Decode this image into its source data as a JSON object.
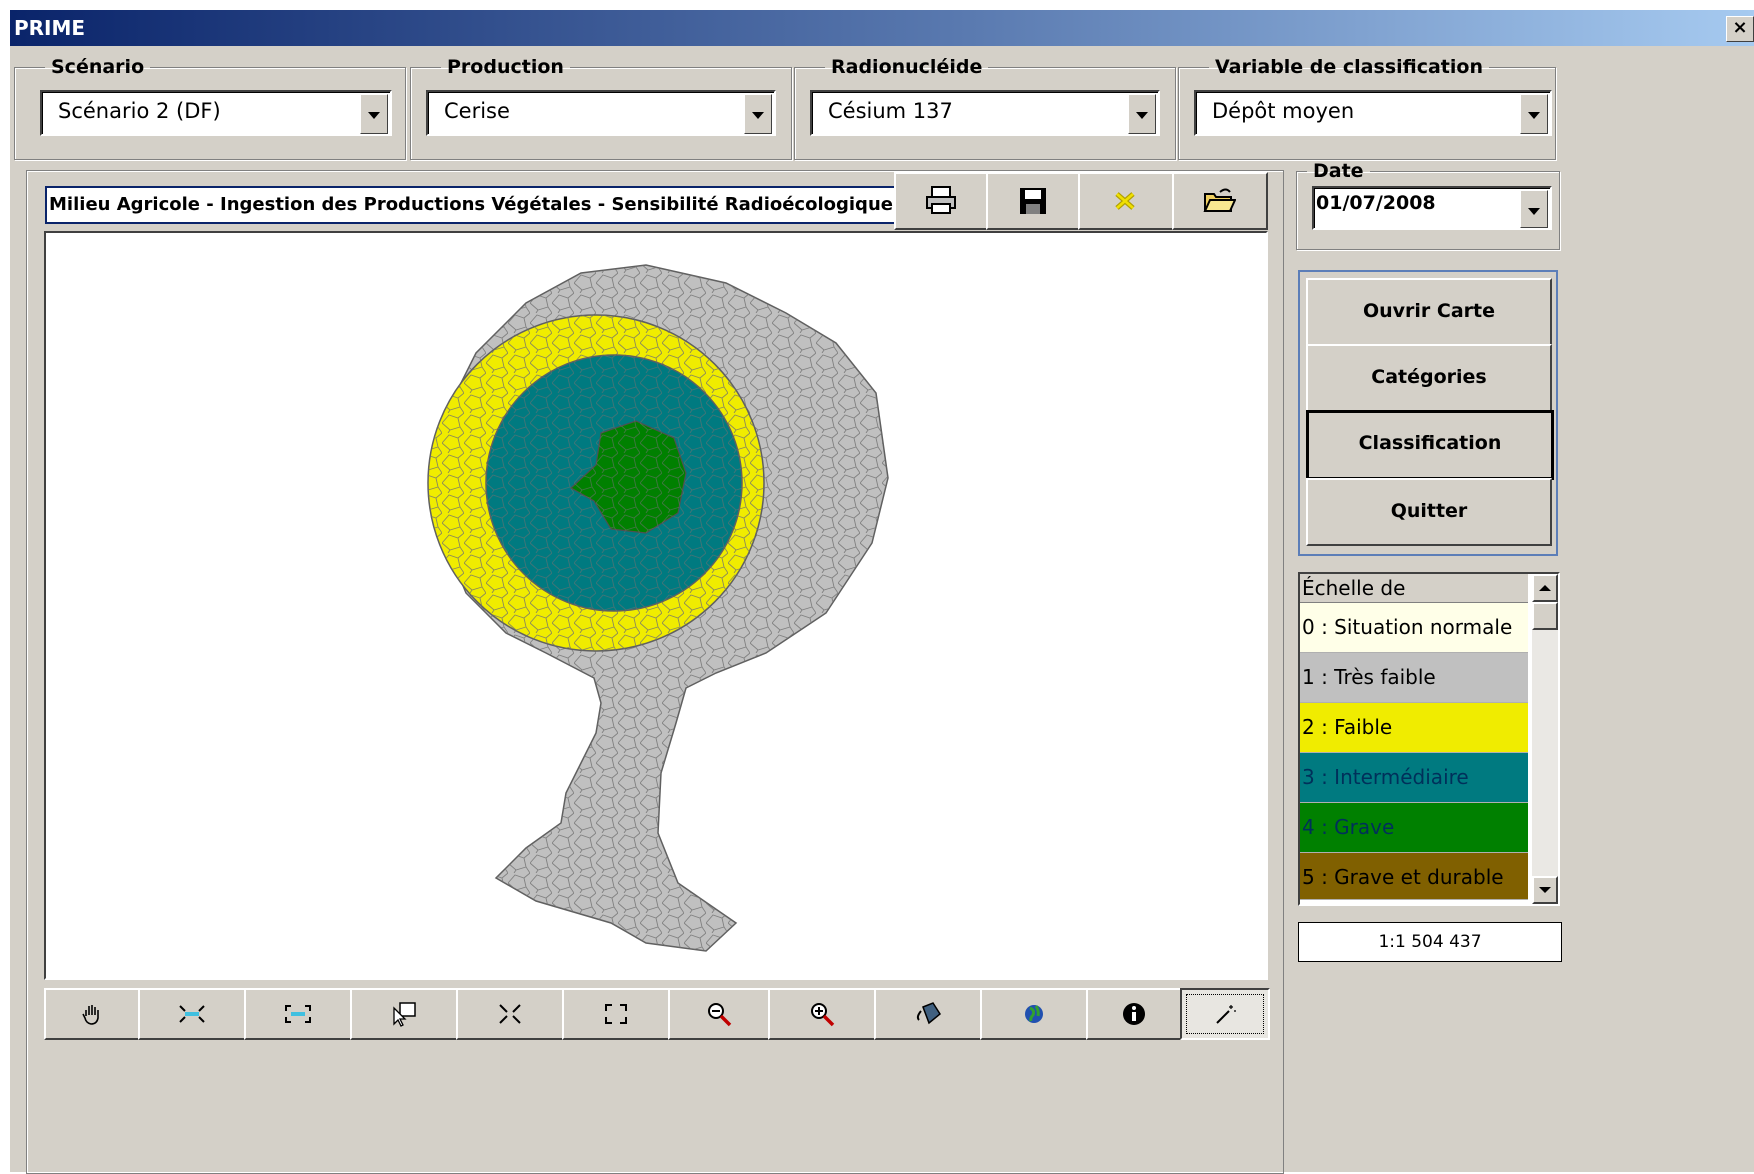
{
  "window": {
    "title": "PRIME",
    "close_label": "×"
  },
  "groups": {
    "scenario": {
      "label": "Scénario",
      "value": "Scénario 2 (DF)"
    },
    "production": {
      "label": "Production",
      "value": "Cerise"
    },
    "radionuclide": {
      "label": "Radionucléide",
      "value": "Césium 137"
    },
    "classification_variable": {
      "label": "Variable de classification",
      "value": "Dépôt moyen"
    },
    "date": {
      "label": "Date",
      "value": "01/07/2008"
    }
  },
  "map": {
    "title": "Milieu Agricole - Ingestion des Productions Végétales - Sensibilité Radioécologique",
    "scale": "1:1 504 437"
  },
  "toolbar_icons": [
    "printer-icon",
    "floppy-save-icon",
    "clear-icon",
    "open-folder-icon"
  ],
  "map_tools": [
    "pan-hand-icon",
    "zoom-in-fixed-icon",
    "zoom-out-fixed-icon",
    "select-feature-icon",
    "shrink-icon",
    "expand-icon",
    "zoom-out-icon",
    "zoom-in-icon",
    "paint-bucket-icon",
    "globe-icon",
    "info-icon",
    "magic-wand-icon"
  ],
  "commands": {
    "open_map": "Ouvrir Carte",
    "categories": "Catégories",
    "classification": "Classification",
    "quit": "Quitter"
  },
  "legend": {
    "header": "Échelle de classification",
    "items": [
      {
        "label": "0 : Situation normale",
        "color": "#ffffe8"
      },
      {
        "label": "1 : Très faible",
        "color": "#c0c0c0"
      },
      {
        "label": "2 : Faible",
        "color": "#f0ec00"
      },
      {
        "label": "3 : Intermédiaire",
        "color": "#007a80"
      },
      {
        "label": "4 : Grave",
        "color": "#008000"
      },
      {
        "label": "5 : Grave et durable",
        "color": "#806000"
      }
    ]
  },
  "colors": {
    "title_bar": "#0a246a",
    "gray_zone": "#c0c0c0",
    "yellow_zone": "#f0ec00",
    "teal_zone": "#007a80",
    "green_zone": "#008000"
  }
}
